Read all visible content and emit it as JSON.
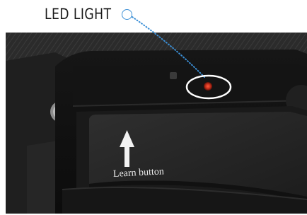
{
  "header": {
    "led_label": "LED LIGHT"
  },
  "photo": {
    "learn_button_text": "Learn button"
  },
  "colors": {
    "callout_accent": "#3b8fd6",
    "highlight_ring": "#ffffff",
    "led": "#c8301c"
  },
  "icons": {
    "callout_marker": "circle-outline-icon",
    "arrow": "up-arrow-icon"
  }
}
